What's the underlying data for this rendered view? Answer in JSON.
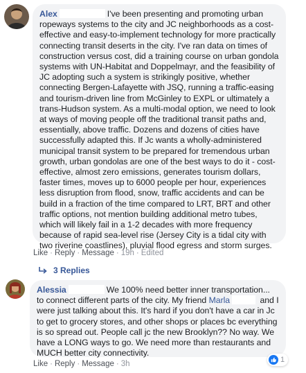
{
  "comments": [
    {
      "author": "Alex",
      "text_parts": [
        "I've been presenting and promoting urban ropeways systems to the city and JC neighborhoods as a cost-effective and easy-to-implement technology for more practically connecting transit deserts in the city. I've ran data on times of construction versus cost, did a training course on urban gondola systems with UN-Habitat and Doppelmayr, and the feasibility of JC adopting such a system is strikingly positive, whether connecting Bergen-Lafayette with JSQ, running a traffic-easing and tourism-driven line from McGinley to EXPL or ultimately a trans-Hudson system. As a multi-modal option, we need to look at ways of moving people off the traditional transit paths and, essentially, above traffic. Dozens and dozens of cities have successfully adapted this. If Jc wants a wholly-administered municipal transit system to be prepared for tremendous urban growth, urban gondolas are one of the best ways to do it - cost-effective, almost zero emissions, generates tourism dollars, faster times, moves up to 6000 people per hour, experiences less disruption from flood, snow, traffic accidents and can be build in a fraction of the time compared to LRT, BRT and other traffic options, not mention building additional metro tubes, which will likely fail in a 1-2 decades with more frequency because of rapid sea-level rise (Jersey City is a tidal city with two riverine coastlines), pluvial flood egress and storm surges."
      ],
      "actions": {
        "like": "Like",
        "reply": "Reply",
        "message": "Message",
        "time": "19h",
        "edited": "Edited"
      },
      "replies_label": "3 Replies"
    },
    {
      "author": "Alessia",
      "text_before": "We 100% need better inner transportation... to connect different parts of the city. My friend",
      "mention": "Marla",
      "text_after": "and I were just talking about this. It's hard if you don't have a car in Jc to get to grocery stores, and other shops or places bc everything is so spread out. People call jc the new Brooklyn?? No way. We have a LONG ways to go. We need more than restaurants and MUCH better city connectivity.",
      "actions": {
        "like": "Like",
        "reply": "Reply",
        "message": "Message",
        "time": "3h"
      },
      "reaction_count": "1"
    }
  ],
  "colors": {
    "link": "#385898",
    "bubble": "#f2f3f5",
    "like_blue": "#1877f2"
  }
}
